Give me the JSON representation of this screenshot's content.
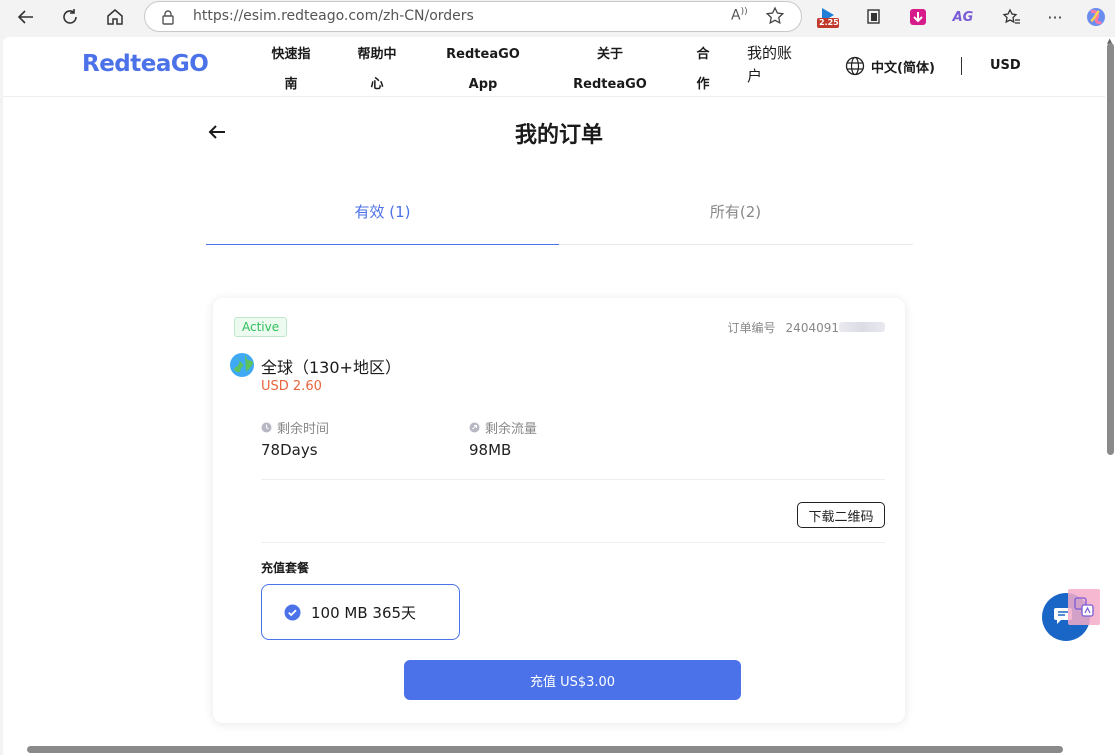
{
  "browser": {
    "url": "https://esim.redteago.com/zh-CN/orders",
    "ext_badge": "2.25",
    "ext_ag_label": "AG",
    "read_aloud_label": "A)"
  },
  "header": {
    "logo": "RedteaGO",
    "nav": [
      {
        "line1": "快速指",
        "line2": "南"
      },
      {
        "line1": "帮助中",
        "line2": "心"
      },
      {
        "line1": "RedteaGO",
        "line2": "App"
      },
      {
        "line1": "关于",
        "line2": "RedteaGO"
      },
      {
        "line1": "合",
        "line2": "作"
      },
      {
        "line1": "我的账",
        "line2": "户"
      }
    ],
    "language": "中文(简体)",
    "currency": "USD"
  },
  "page": {
    "title": "我的订单"
  },
  "tabs": [
    {
      "label": "有效 (1)"
    },
    {
      "label": "所有(2)"
    }
  ],
  "order": {
    "status": "Active",
    "order_no_label": "订单编号",
    "order_no_prefix": "2404091",
    "plan_name": "全球（130+地区）",
    "price": "USD 2.60",
    "remaining_time_label": "剩余时间",
    "remaining_time": "78Days",
    "remaining_data_label": "剩余流量",
    "remaining_data": "98MB",
    "qr_button": "下载二维码",
    "recharge_label": "充值套餐",
    "package": "100 MB 365天",
    "pay_button": "充值 US$3.00"
  },
  "colors": {
    "brand": "#4b72e8",
    "price": "#e8643c",
    "active": "#2fbf5a",
    "chat": "#1a66c7"
  }
}
